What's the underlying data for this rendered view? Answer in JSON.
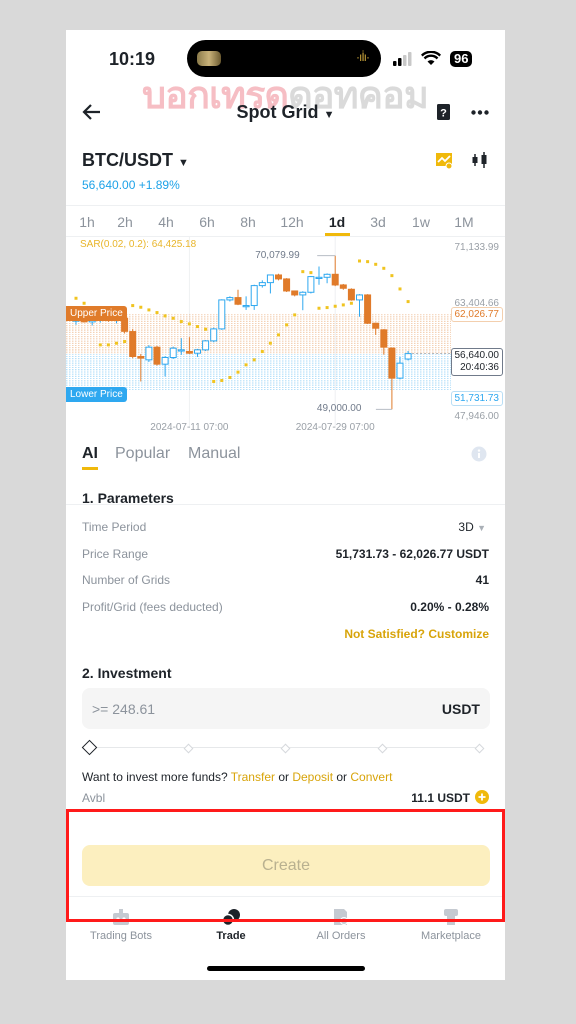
{
  "status_bar": {
    "time": "10:19",
    "battery": "96"
  },
  "watermark": {
    "part1": "บอกเทรด",
    "part2": "ดอทคอม"
  },
  "header": {
    "title": "Spot Grid",
    "back_icon": "arrow-left-icon",
    "help_icon": "guide-icon",
    "more_icon": "more-dots-icon"
  },
  "pair": {
    "symbol": "BTC/USDT",
    "last_price": "56,640.00",
    "change": "+1.89%",
    "price_color": "#1da2e8",
    "indicator_icon": "chart-indicator-icon",
    "candle_icon": "candlestick-icon"
  },
  "timeframes": [
    {
      "label": "1h"
    },
    {
      "label": "2h"
    },
    {
      "label": "4h"
    },
    {
      "label": "6h"
    },
    {
      "label": "8h"
    },
    {
      "label": "12h"
    },
    {
      "label": "1d"
    },
    {
      "label": "3d"
    },
    {
      "label": "1w"
    },
    {
      "label": "1M"
    }
  ],
  "selected_timeframe": "1d",
  "chart_data": {
    "type": "candlestick",
    "indicator_label": "SAR(0.02, 0.2): 64,425.18",
    "y_ticks": [
      "71,133.99",
      "63,404.66",
      "47,946.00"
    ],
    "ylim": [
      47946,
      71133.99
    ],
    "x_ticks": [
      {
        "index": 14,
        "label": "2024-07-11 07:00"
      },
      {
        "index": 32,
        "label": "2024-07-29 07:00"
      }
    ],
    "upper_price": {
      "label": "Upper Price",
      "value": 62026.77,
      "text": "62,026.77"
    },
    "lower_price": {
      "label": "Lower Price",
      "value": 51731.73,
      "text": "51,731.73"
    },
    "current_price": {
      "value": 56640,
      "text": "56,640.00",
      "countdown": "20:40:36"
    },
    "grids": 41,
    "high_marker": {
      "index": 32,
      "value": 70079.99,
      "text": "70,079.99"
    },
    "low_marker": {
      "index": 39,
      "value": 49000,
      "text": "49,000.00"
    },
    "colors": {
      "up": "#2ea8f0",
      "down": "#e07b2a",
      "sar": "#f0c420",
      "upper": "#e07b2a",
      "lower": "#2ea8f0"
    },
    "candles": [
      [
        61100,
        62000,
        60600,
        61600
      ],
      [
        61400,
        62000,
        60900,
        61000
      ],
      [
        61000,
        61700,
        60500,
        61400
      ],
      [
        61400,
        62800,
        60900,
        61600
      ],
      [
        61600,
        62400,
        61000,
        61200
      ],
      [
        61200,
        61800,
        60800,
        61500
      ],
      [
        61500,
        62100,
        59400,
        59700
      ],
      [
        59670,
        60000,
        56000,
        56245
      ],
      [
        56250,
        56600,
        52820,
        56020
      ],
      [
        55790,
        57800,
        55500,
        57525
      ],
      [
        57525,
        57700,
        55000,
        55195
      ],
      [
        55195,
        56300,
        53505,
        56110
      ],
      [
        56110,
        57600,
        55900,
        57390
      ],
      [
        57100,
        58760,
        56470,
        57160
      ],
      [
        56930,
        58900,
        56600,
        56700
      ],
      [
        56700,
        57300,
        56200,
        57160
      ],
      [
        57160,
        58500,
        57000,
        58390
      ],
      [
        58390,
        60200,
        58200,
        60035
      ],
      [
        60035,
        64100,
        59900,
        64010
      ],
      [
        64010,
        64500,
        63800,
        64330
      ],
      [
        64330,
        65400,
        63300,
        63420
      ],
      [
        63240,
        64500,
        62640,
        63240
      ],
      [
        63240,
        66100,
        62640,
        65975
      ],
      [
        65975,
        66700,
        65700,
        66385
      ],
      [
        66385,
        67435,
        64900,
        67435
      ],
      [
        67435,
        67600,
        66700,
        66890
      ],
      [
        66890,
        67000,
        65100,
        65240
      ],
      [
        65240,
        65300,
        64500,
        64695
      ],
      [
        64695,
        65200,
        62600,
        65060
      ],
      [
        65060,
        67300,
        64900,
        67210
      ],
      [
        67115,
        68600,
        66100,
        67115
      ],
      [
        67115,
        67650,
        66300,
        67525
      ],
      [
        67525,
        70079.99,
        65900,
        66065
      ],
      [
        66065,
        66200,
        65400,
        65610
      ],
      [
        65470,
        65600,
        63900,
        64010
      ],
      [
        64010,
        64800,
        61700,
        64695
      ],
      [
        64695,
        64800,
        60700,
        60813
      ],
      [
        60813,
        60900,
        59200,
        60130
      ],
      [
        59900,
        60000,
        56500,
        57525
      ],
      [
        57390,
        57500,
        49000,
        53277
      ],
      [
        53277,
        56200,
        53100,
        55330
      ],
      [
        55900,
        57000,
        55700,
        56640
      ]
    ],
    "sar": [
      64238,
      63553,
      62868,
      57844,
      57844,
      58072,
      58300,
      63233,
      63005,
      62640,
      62274,
      61818,
      61497,
      61041,
      60721,
      60356,
      59990,
      52820,
      52957,
      53368,
      54100,
      55104,
      55789,
      56930,
      58073,
      59214,
      60585,
      61955,
      67891,
      67754,
      62868,
      62960,
      63142,
      63325,
      63553,
      69353,
      69262,
      68896,
      68348,
      67343,
      65516,
      63781
    ]
  },
  "strategy_tabs": [
    {
      "label": "AI"
    },
    {
      "label": "Popular"
    },
    {
      "label": "Manual"
    }
  ],
  "parameters": {
    "heading": "1. Parameters",
    "rows": [
      {
        "label": "Time Period",
        "value": "3D"
      },
      {
        "label": "Price Range",
        "value": "51,731.73 - 62,026.77 USDT"
      },
      {
        "label": "Number of Grids",
        "value": "41"
      },
      {
        "label": "Profit/Grid (fees deducted)",
        "value": "0.20% - 0.28%"
      }
    ],
    "customize_link": "Not Satisfied? Customize"
  },
  "investment": {
    "heading": "2. Investment",
    "placeholder": ">= 248.61",
    "unit": "USDT",
    "slider_percent": 0,
    "more_funds_text": "Want to invest more funds?",
    "or": "or",
    "transfer": "Transfer",
    "deposit": "Deposit",
    "convert": "Convert",
    "avbl_label": "Avbl",
    "avbl_value": "11.1 USDT"
  },
  "create_button": "Create",
  "bottom_nav": [
    {
      "label": "Trading Bots",
      "icon": "robot-icon"
    },
    {
      "label": "Trade",
      "icon": "trade-icon",
      "active": true
    },
    {
      "label": "All Orders",
      "icon": "orders-icon"
    },
    {
      "label": "Marketplace",
      "icon": "marketplace-icon"
    }
  ]
}
